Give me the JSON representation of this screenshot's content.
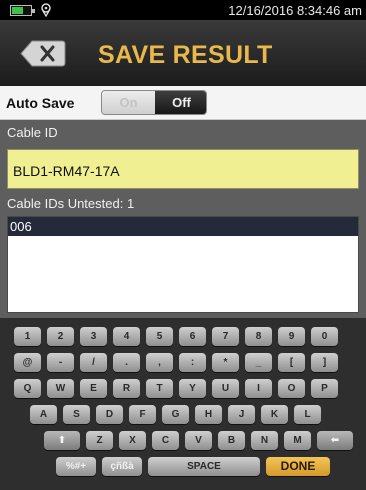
{
  "status_bar": {
    "datetime": "12/16/2016 8:34:46 am",
    "battery_level": 0.6
  },
  "header": {
    "title": "SAVE RESULT",
    "back_icon": "backspace-x-icon"
  },
  "auto_save": {
    "label": "Auto Save",
    "on_label": "On",
    "off_label": "Off",
    "selected": "Off"
  },
  "cable": {
    "label": "Cable ID",
    "value": "BLD1-RM47-17A"
  },
  "untested": {
    "label": "Cable IDs Untested: 1",
    "items": [
      "006"
    ]
  },
  "keyboard": {
    "row1": [
      "1",
      "2",
      "3",
      "4",
      "5",
      "6",
      "7",
      "8",
      "9",
      "0"
    ],
    "row2": [
      "@",
      "-",
      "/",
      ".",
      ",",
      ":",
      "*",
      "_",
      "[",
      "]"
    ],
    "row3": [
      "Q",
      "W",
      "E",
      "R",
      "T",
      "Y",
      "U",
      "I",
      "O",
      "P"
    ],
    "row4": [
      "A",
      "S",
      "D",
      "F",
      "G",
      "H",
      "J",
      "K",
      "L"
    ],
    "row5": {
      "shift": "⬆",
      "letters": [
        "Z",
        "X",
        "C",
        "V",
        "B",
        "N",
        "M"
      ],
      "backspace": "⬅"
    },
    "row6": {
      "symbols": "%#+",
      "accents": "çñßà",
      "space": "SPACE",
      "done": "DONE"
    }
  }
}
